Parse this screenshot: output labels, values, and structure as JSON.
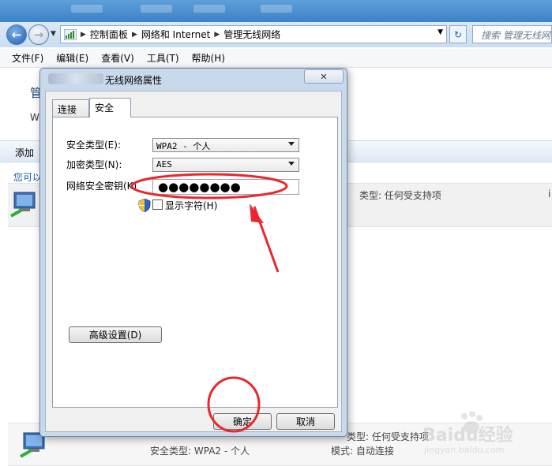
{
  "address_bar": {
    "breadcrumbs": [
      "控制面板",
      "网络和 Internet",
      "管理无线网络"
    ],
    "search_placeholder": "搜索 管理无线网络"
  },
  "menu": [
    "文件(F)",
    "编辑(E)",
    "查看(V)",
    "工具(T)",
    "帮助(H)"
  ],
  "background": {
    "title_partial": "管",
    "subtitle_partial": "W",
    "toolbar_add": "添加",
    "hint_partial": "您可以",
    "row1_type": "类型: 任何受支持项",
    "row1_edge": "i",
    "row2_type": "类型: 任何受支持项",
    "row2_security": "安全类型: WPA2 - 个人",
    "row2_mode": "模式: 自动连接"
  },
  "dialog": {
    "title": "无线网络属性",
    "close_label": "✕",
    "tabs": [
      "连接",
      "安全"
    ],
    "active_tab": "安全",
    "security_type_label": "安全类型(E):",
    "security_type_value": "WPA2 - 个人",
    "encryption_type_label": "加密类型(N):",
    "encryption_type_value": "AES",
    "key_label": "网络安全密钥(K)",
    "key_value": "●●●●●●●●",
    "show_chars_label": "显示字符(H)",
    "show_chars_checked": false,
    "advanced_button": "高级设置(D)",
    "ok_button": "确定",
    "cancel_button": "取消"
  },
  "watermark": {
    "brand": "Baidu经验",
    "url": "jingyan.baidu.com"
  },
  "colors": {
    "annotation_red": "#e8282c",
    "titlebar_blue": "#4a8fd1"
  }
}
